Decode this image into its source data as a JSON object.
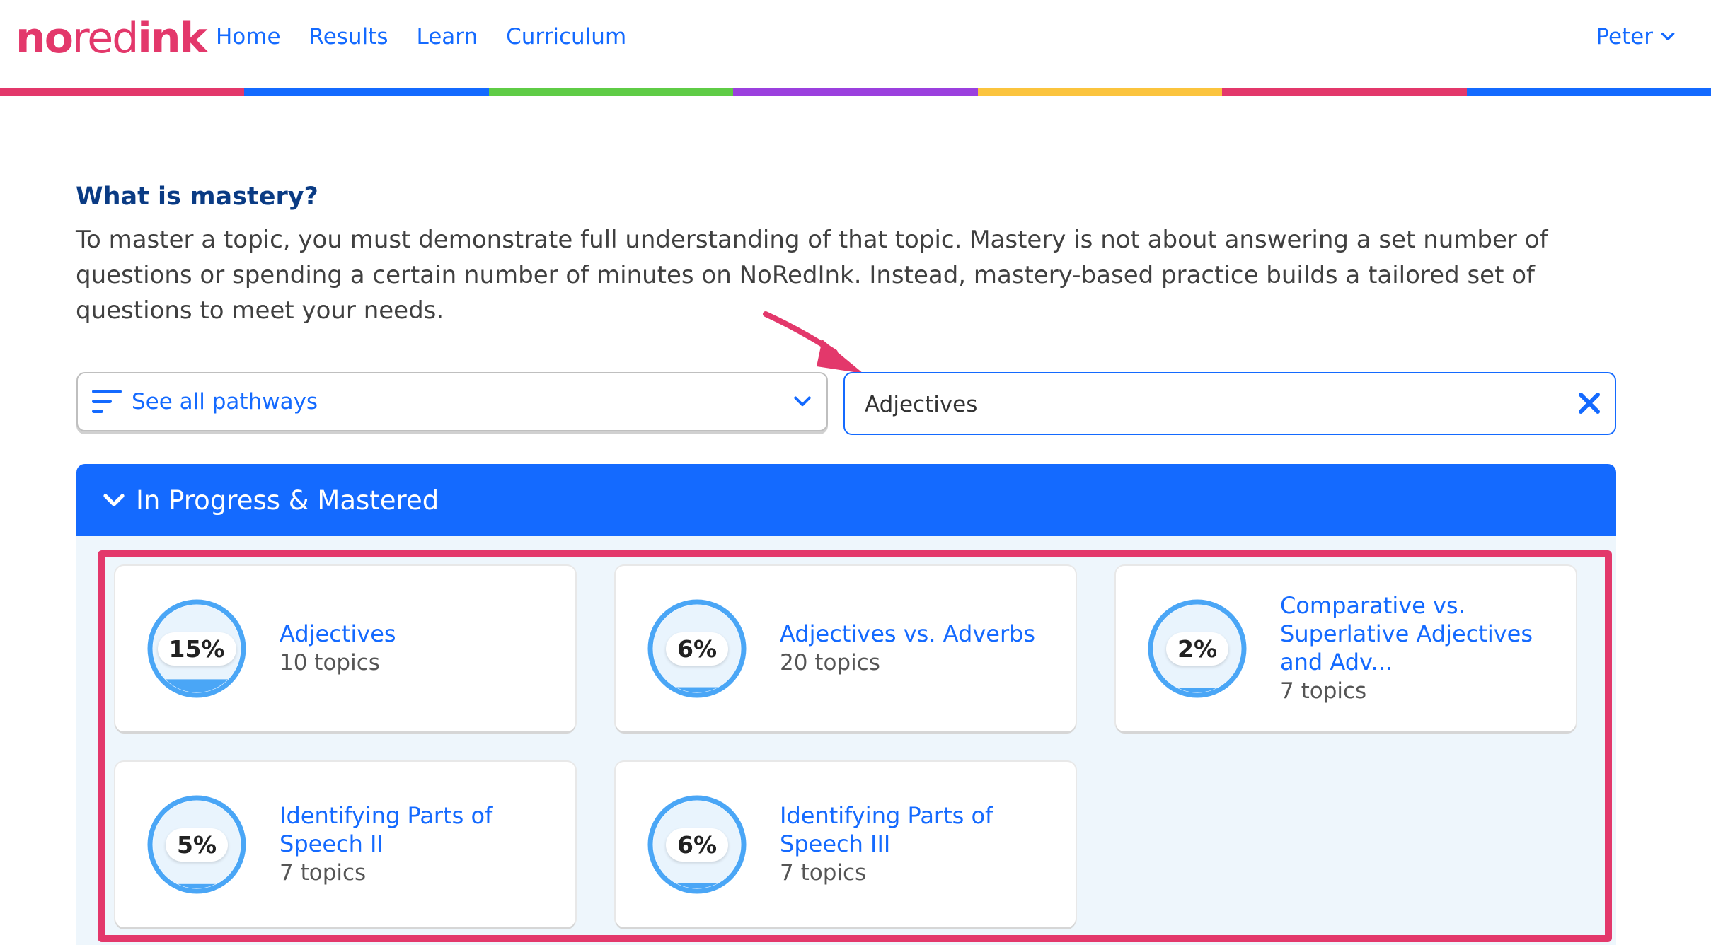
{
  "header": {
    "logo": {
      "part1": "no",
      "part2": "red",
      "part3": "ink"
    },
    "nav": [
      "Home",
      "Results",
      "Learn",
      "Curriculum"
    ],
    "user": "Peter",
    "rainbow_colors": [
      "#e3386b",
      "#146aff",
      "#5fcc46",
      "#9b40de",
      "#fbc43e",
      "#e3386b",
      "#146aff"
    ]
  },
  "intro": {
    "title": "What is mastery?",
    "text": "To master a topic, you must demonstrate full understanding of that topic. Mastery is not about answering a set number of questions or spending a certain number of minutes on NoRedInk. Instead, mastery-based practice builds a tailored set of questions to meet your needs."
  },
  "pathways": {
    "label": "See all pathways",
    "icon": "filter-lines-icon"
  },
  "search": {
    "value": "Adjectives"
  },
  "section": {
    "title": "In Progress & Mastered"
  },
  "cards": [
    {
      "percent": "15%",
      "progress": 0.15,
      "title": "Adjectives",
      "subtitle": "10 topics"
    },
    {
      "percent": "6%",
      "progress": 0.06,
      "title": "Adjectives vs. Adverbs",
      "subtitle": "20 topics"
    },
    {
      "percent": "2%",
      "progress": 0.02,
      "title": "Comparative vs. Superlative Adjectives and Adv...",
      "subtitle": "7 topics"
    },
    {
      "percent": "5%",
      "progress": 0.05,
      "title": "Identifying Parts of Speech II",
      "subtitle": "7 topics"
    },
    {
      "percent": "6%",
      "progress": 0.06,
      "title": "Identifying Parts of Speech III",
      "subtitle": "7 topics"
    }
  ],
  "colors": {
    "accent": "#146aff",
    "brand_red": "#e3386b",
    "ring": "#4aa6f6",
    "ring_fill": "#e9f4fd"
  }
}
